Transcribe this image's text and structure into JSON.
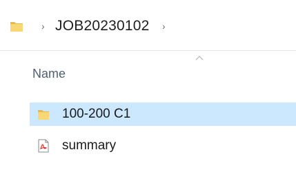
{
  "address_bar": {
    "separator": "›",
    "current_folder": "JOB20230102",
    "trailing_separator": "›",
    "folder_icon": "folder-icon"
  },
  "file_list": {
    "sort_indicator_icon": "sort-up-icon",
    "column_header": "Name",
    "items": [
      {
        "name": "100-200 C1",
        "icon": "folder-icon",
        "selected": true
      },
      {
        "name": "summary",
        "icon": "pdf-file-icon",
        "selected": false
      }
    ]
  },
  "colors": {
    "selection": "#cce8ff",
    "folder": "#f8d775",
    "pdf_accent": "#d93025",
    "header_text": "#4d6073"
  }
}
